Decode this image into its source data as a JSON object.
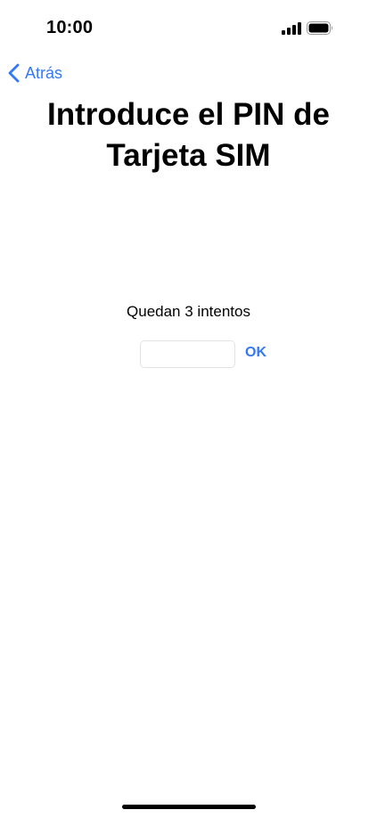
{
  "status_bar": {
    "time": "10:00",
    "signal_icon": "cellular-signal-icon",
    "battery_icon": "battery-icon"
  },
  "nav": {
    "back_label": "Atrás",
    "back_icon": "chevron-left-icon"
  },
  "title": "Introduce el PIN de Tarjeta SIM",
  "attempts_text": "Quedan 3 intentos",
  "pin_input": {
    "value": "",
    "placeholder": ""
  },
  "ok_label": "OK",
  "colors": {
    "accent": "#3478f6",
    "text": "#000000",
    "background": "#ffffff"
  }
}
